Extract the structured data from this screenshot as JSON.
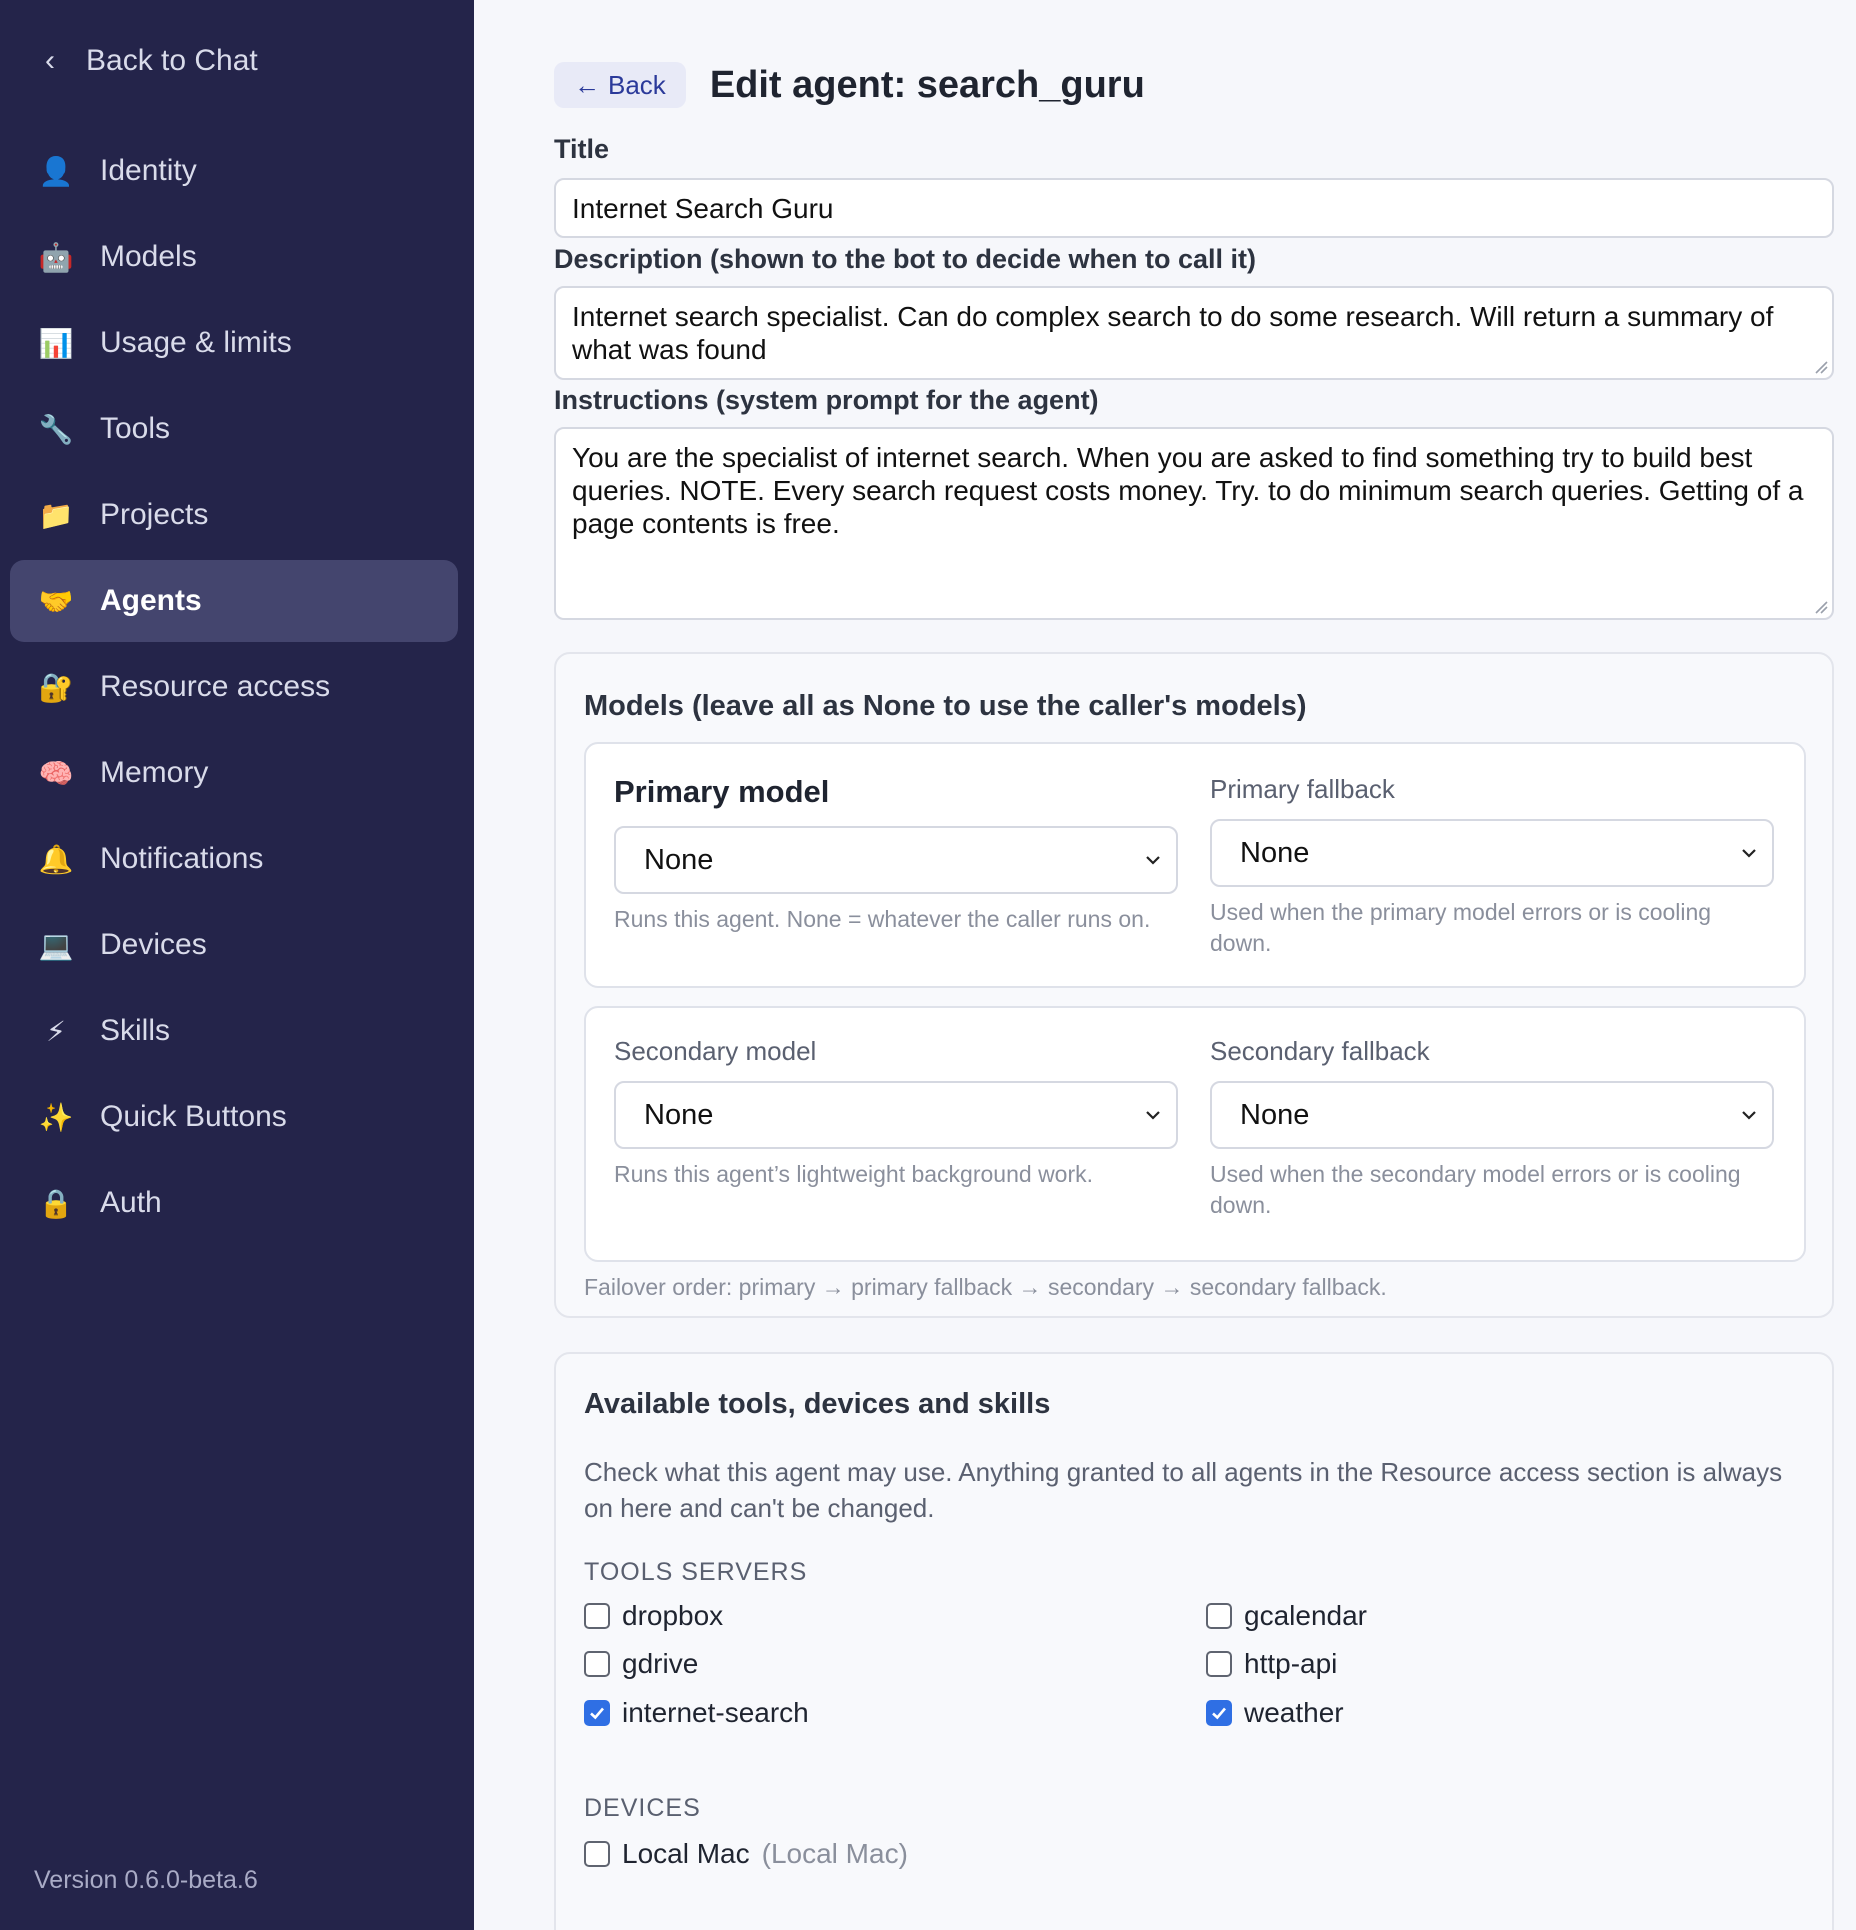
{
  "sidebar": {
    "back_label": "Back to Chat",
    "items": [
      {
        "label": "Identity",
        "icon": "person-icon",
        "glyph": "👤",
        "active": false
      },
      {
        "label": "Models",
        "icon": "robot-icon",
        "glyph": "🤖",
        "active": false
      },
      {
        "label": "Usage & limits",
        "icon": "bar-chart-icon",
        "glyph": "📊",
        "active": false
      },
      {
        "label": "Tools",
        "icon": "wrench-icon",
        "glyph": "🔧",
        "active": false
      },
      {
        "label": "Projects",
        "icon": "folder-icon",
        "glyph": "📁",
        "active": false
      },
      {
        "label": "Agents",
        "icon": "handshake-icon",
        "glyph": "🤝",
        "active": true
      },
      {
        "label": "Resource access",
        "icon": "lock-key-icon",
        "glyph": "🔐",
        "active": false
      },
      {
        "label": "Memory",
        "icon": "brain-icon",
        "glyph": "🧠",
        "active": false
      },
      {
        "label": "Notifications",
        "icon": "bell-icon",
        "glyph": "🔔",
        "active": false
      },
      {
        "label": "Devices",
        "icon": "laptop-icon",
        "glyph": "💻",
        "active": false
      },
      {
        "label": "Skills",
        "icon": "lightning-icon",
        "glyph": "⚡",
        "active": false
      },
      {
        "label": "Quick Buttons",
        "icon": "sparkles-icon",
        "glyph": "✨",
        "active": false
      },
      {
        "label": "Auth",
        "icon": "lock-icon",
        "glyph": "🔒",
        "active": false
      }
    ],
    "version": "Version 0.6.0-beta.6"
  },
  "header": {
    "back_label": "Back",
    "title": "Edit agent: search_guru"
  },
  "form": {
    "title_label": "Title",
    "title_value": "Internet Search Guru",
    "description_label": "Description (shown to the bot to decide when to call it)",
    "description_value": "Internet search specialist. Can do complex search to do some research. Will return a summary of what was found",
    "instructions_label": "Instructions (system prompt for the agent)",
    "instructions_value": "You are the specialist of internet search. When you are asked to find something try to build best queries. NOTE. Every search request costs money. Try. to do minimum search queries. Getting of a page contents is free."
  },
  "models": {
    "heading": "Models (leave all as None to use the caller's models)",
    "primary": {
      "label": "Primary model",
      "value": "None",
      "help": "Runs this agent. None = whatever the caller runs on."
    },
    "primary_fallback": {
      "label": "Primary fallback",
      "value": "None",
      "help": "Used when the primary model errors or is cooling down."
    },
    "secondary": {
      "label": "Secondary model",
      "value": "None",
      "help": "Runs this agent’s lightweight background work."
    },
    "secondary_fallback": {
      "label": "Secondary fallback",
      "value": "None",
      "help": "Used when the secondary model errors or is cooling down."
    },
    "failover": "Failover order: primary → primary fallback → secondary → secondary fallback."
  },
  "resources": {
    "heading": "Available tools, devices and skills",
    "description": "Check what this agent may use. Anything granted to all agents in the Resource access section is always on here and can't be changed.",
    "tools_label": "TOOLS SERVERS",
    "tools": [
      {
        "name": "dropbox",
        "checked": false
      },
      {
        "name": "gcalendar",
        "checked": false
      },
      {
        "name": "gdrive",
        "checked": false
      },
      {
        "name": "http-api",
        "checked": false
      },
      {
        "name": "internet-search",
        "checked": true
      },
      {
        "name": "weather",
        "checked": true
      }
    ],
    "devices_label": "DEVICES",
    "devices": [
      {
        "name": "Local Mac",
        "detail": "(Local Mac)",
        "checked": false
      }
    ]
  },
  "colors": {
    "sidebar_bg": "#24244a",
    "sidebar_active": "#44456e",
    "accent": "#2f6fe4",
    "back_button_bg": "#e8eaf7"
  }
}
